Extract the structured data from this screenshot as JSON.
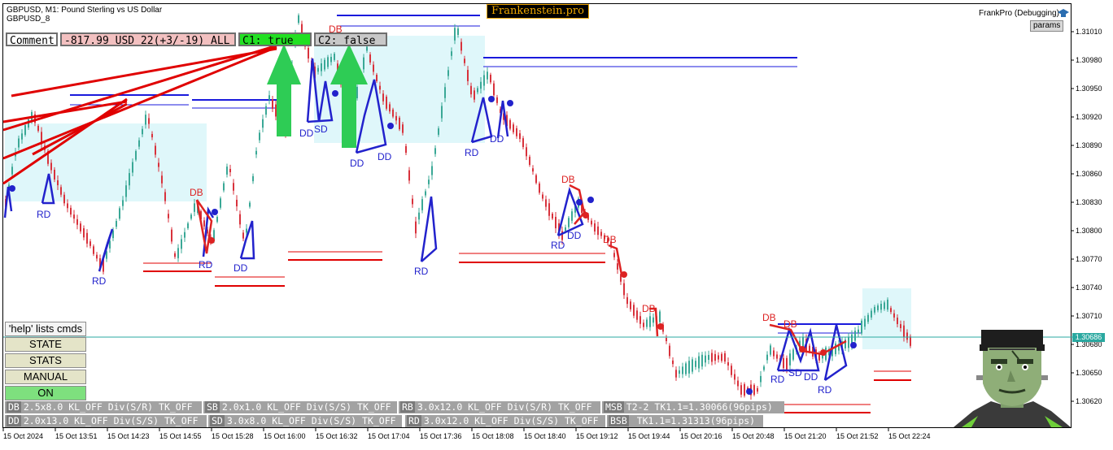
{
  "header": {
    "symbol_line": "GBPUSD, M1:  Pound Sterling vs US Dollar",
    "symbol_short": "GBPUSD_8",
    "logo_text": "Frankenstein.pro",
    "ea_name": "FrankPro (Debugging)",
    "params_label": "params"
  },
  "panel": {
    "comment_label": "Comment",
    "pnl_text": "-817.99 USD 22(+3/-19) ALL",
    "c1_text": "C1: true",
    "c2_text": "C2: false"
  },
  "buttons": {
    "help": "'help' lists cmds",
    "state": "STATE",
    "stats": "STATS",
    "manual": "MANUAL",
    "on": "ON"
  },
  "status_bar": {
    "row1": [
      {
        "tag": "DB",
        "text": "2.5x8.0 KL_OFF Div(S/R) TK_OFF"
      },
      {
        "tag": "SB",
        "text": "2.0x1.0 KL_OFF Div(S/S) TK_OFF"
      },
      {
        "tag": "RB",
        "text": "3.0x12.0 KL_OFF Div(S/R) TK_OFF"
      },
      {
        "tag": "MSB",
        "text": "T2-2  TK1.1=1.30066(96pips)"
      }
    ],
    "row2": [
      {
        "tag": "DD",
        "text": "2.0x13.0 KL_OFF Div(S/S) TK_OFF"
      },
      {
        "tag": "SD",
        "text": "3.0x8.0 KL_OFF Div(S/S) TK_OFF"
      },
      {
        "tag": "RD",
        "text": "3.0x12.0 KL_OFF Div(S/S) TK_OFF"
      },
      {
        "tag": "BSB",
        "text": " TK1.1=1.31313(96pips)"
      }
    ]
  },
  "price_axis": {
    "ticks": [
      "1.31010",
      "1.30980",
      "1.30950",
      "1.30920",
      "1.30890",
      "1.30860",
      "1.30830",
      "1.30800",
      "1.30770",
      "1.30740",
      "1.30710",
      "1.30680",
      "1.30650",
      "1.30620"
    ],
    "current_price": "1.30686",
    "min": 1.30601,
    "max": 1.31032
  },
  "time_axis": {
    "ticks": [
      "15 Oct 2024",
      "15 Oct 13:51",
      "15 Oct 14:23",
      "15 Oct 14:55",
      "15 Oct 15:28",
      "15 Oct 16:00",
      "15 Oct 16:32",
      "15 Oct 17:04",
      "15 Oct 17:36",
      "15 Oct 18:08",
      "15 Oct 18:40",
      "15 Oct 19:12",
      "15 Oct 19:44",
      "15 Oct 20:16",
      "15 Oct 20:48",
      "15 Oct 21:20",
      "15 Oct 21:52",
      "15 Oct 22:24"
    ]
  },
  "pattern_labels": {
    "rd": "RD",
    "dd": "DD",
    "sd": "SD",
    "db": "DB"
  },
  "colors": {
    "bull_candle": "#3aa896",
    "bear_candle": "#d8323c",
    "zone_fill": "#dff7fa",
    "blue_line": "#1a1adc",
    "red_line": "#e00000",
    "pattern_blue": "#2222cc",
    "pattern_red": "#dd2222",
    "c1_green": "#22e022",
    "arrow_green": "#2ecc55",
    "current_price_line": "#2aa8a0"
  }
}
